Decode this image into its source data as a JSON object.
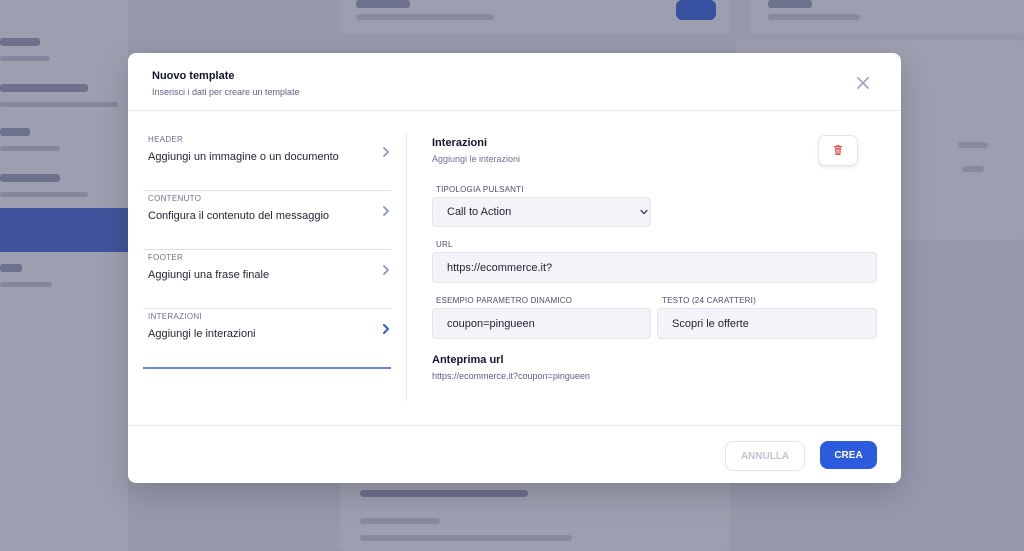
{
  "modal": {
    "title": "Nuovo template",
    "subtitle": "Inserisci i dati per creare un template",
    "close_icon": "close-icon"
  },
  "sections": [
    {
      "caps": "HEADER",
      "text": "Aggiungi un immagine o un documento",
      "active": false
    },
    {
      "caps": "CONTENUTO",
      "text": "Configura il contenuto del messaggio",
      "active": false
    },
    {
      "caps": "FOOTER",
      "text": "Aggiungi una frase finale",
      "active": false
    },
    {
      "caps": "INTERAZIONI",
      "text": "Aggiungi le interazioni",
      "active": true
    }
  ],
  "interactions": {
    "title": "Interazioni",
    "subtitle": "Aggiungi le interazioni",
    "delete_icon": "trash-icon",
    "button_type_label": "TIPOLOGIA PULSANTI",
    "button_type_value": "Call to Action",
    "url_label": "URL",
    "url_value": "https://ecommerce.it?",
    "dynamic_param_label": "ESEMPIO PARAMETRO DINAMICO",
    "dynamic_param_value": "coupon=pingueen",
    "text_label": "TESTO (24 CARATTERI)",
    "text_value": "Scopri le offerte",
    "preview_title": "Anteprima url",
    "preview_value": "https://ecommerce.it?coupon=pingueen"
  },
  "footer": {
    "cancel_label": "ANNULLA",
    "create_label": "CREA"
  },
  "colors": {
    "primary": "#2d5bde",
    "overlay": "#434768",
    "delete": "#e0524f",
    "active_chevron": "#2d5bde",
    "chevron": "#8a97c7"
  }
}
